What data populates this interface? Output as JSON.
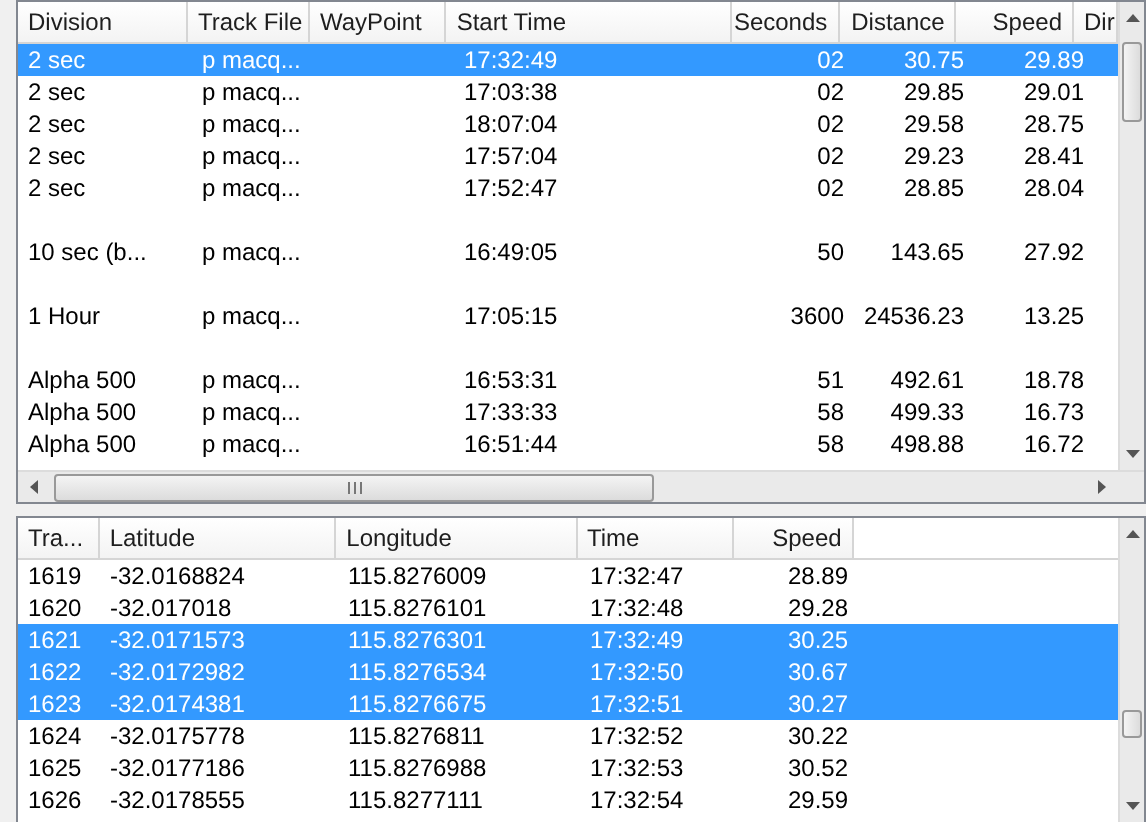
{
  "divisions_table": {
    "columns": [
      "Division",
      "Track File",
      "WayPoint",
      "Start Time",
      "Seconds",
      "Distance",
      "Speed",
      "Dir"
    ],
    "rows": [
      {
        "kind": "data",
        "selected": true,
        "cells": [
          "2 sec",
          "p macq...",
          "",
          "17:32:49",
          "02",
          "30.75",
          "29.89",
          ""
        ]
      },
      {
        "kind": "data",
        "selected": false,
        "cells": [
          "2 sec",
          "p macq...",
          "",
          "17:03:38",
          "02",
          "29.85",
          "29.01",
          ""
        ]
      },
      {
        "kind": "data",
        "selected": false,
        "cells": [
          "2 sec",
          "p macq...",
          "",
          "18:07:04",
          "02",
          "29.58",
          "28.75",
          ""
        ]
      },
      {
        "kind": "data",
        "selected": false,
        "cells": [
          "2 sec",
          "p macq...",
          "",
          "17:57:04",
          "02",
          "29.23",
          "28.41",
          ""
        ]
      },
      {
        "kind": "data",
        "selected": false,
        "cells": [
          "2 sec",
          "p macq...",
          "",
          "17:52:47",
          "02",
          "28.85",
          "28.04",
          ""
        ]
      },
      {
        "kind": "spacer"
      },
      {
        "kind": "data",
        "selected": false,
        "cells": [
          "10 sec (b...",
          "p macq...",
          "",
          "16:49:05",
          "50",
          "143.65",
          "27.92",
          ""
        ]
      },
      {
        "kind": "spacer"
      },
      {
        "kind": "data",
        "selected": false,
        "cells": [
          "1 Hour",
          "p macq...",
          "",
          "17:05:15",
          "3600",
          "24536.23",
          "13.25",
          ""
        ]
      },
      {
        "kind": "spacer"
      },
      {
        "kind": "data",
        "selected": false,
        "cells": [
          "Alpha 500",
          "p macq...",
          "",
          "16:53:31",
          "51",
          "492.61",
          "18.78",
          ""
        ]
      },
      {
        "kind": "data",
        "selected": false,
        "cells": [
          "Alpha 500",
          "p macq...",
          "",
          "17:33:33",
          "58",
          "499.33",
          "16.73",
          ""
        ]
      },
      {
        "kind": "data",
        "selected": false,
        "cells": [
          "Alpha 500",
          "p macq...",
          "",
          "16:51:44",
          "58",
          "498.88",
          "16.72",
          ""
        ]
      }
    ]
  },
  "points_table": {
    "columns": [
      "Tra...",
      "Latitude",
      "Longitude",
      "Time",
      "Speed"
    ],
    "rows": [
      {
        "selected": false,
        "cells": [
          "1619",
          "-32.0168824",
          "115.8276009",
          "17:32:47",
          "28.89"
        ]
      },
      {
        "selected": false,
        "cells": [
          "1620",
          "-32.017018",
          "115.8276101",
          "17:32:48",
          "29.28"
        ]
      },
      {
        "selected": true,
        "cells": [
          "1621",
          "-32.0171573",
          "115.8276301",
          "17:32:49",
          "30.25"
        ]
      },
      {
        "selected": true,
        "cells": [
          "1622",
          "-32.0172982",
          "115.8276534",
          "17:32:50",
          "30.67"
        ]
      },
      {
        "selected": true,
        "cells": [
          "1623",
          "-32.0174381",
          "115.8276675",
          "17:32:51",
          "30.27"
        ]
      },
      {
        "selected": false,
        "cells": [
          "1624",
          "-32.0175778",
          "115.8276811",
          "17:32:52",
          "30.22"
        ]
      },
      {
        "selected": false,
        "cells": [
          "1625",
          "-32.0177186",
          "115.8276988",
          "17:32:53",
          "30.52"
        ]
      },
      {
        "selected": false,
        "cells": [
          "1626",
          "-32.0178555",
          "115.8277111",
          "17:32:54",
          "29.59"
        ]
      }
    ]
  }
}
